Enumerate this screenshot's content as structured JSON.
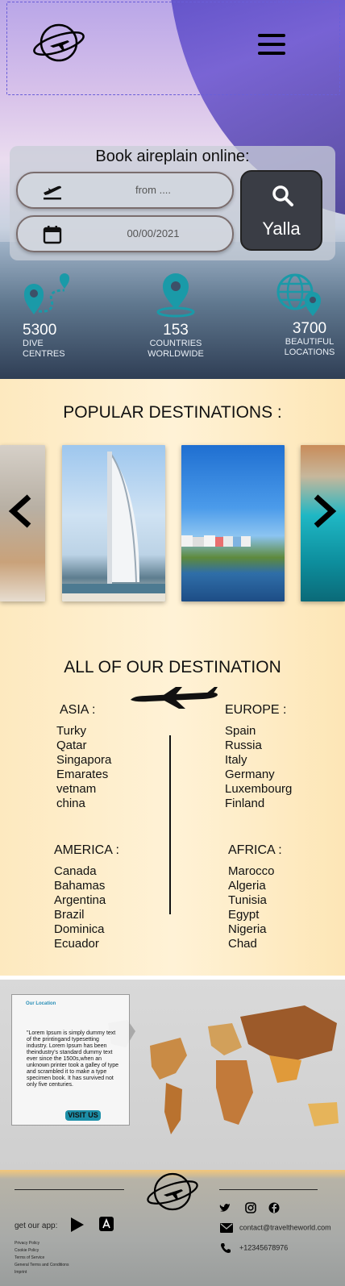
{
  "hero": {
    "booking_title": "Book aireplain online:",
    "from_placeholder": "from ....",
    "date_value": "00/00/2021",
    "search_button": "Yalla",
    "stats": [
      {
        "number": "5300",
        "caption_line1": "DIVE",
        "caption_line2": "CENTRES"
      },
      {
        "number": "153",
        "caption_line1": "COUNTRIES",
        "caption_line2": "WORLDWIDE"
      },
      {
        "number": "3700",
        "caption_line1": "BEAUTIFUL",
        "caption_line2": "LOCATIONS"
      }
    ]
  },
  "popular": {
    "title": "POPULAR DESTINATIONS :"
  },
  "all_destinations": {
    "title": "ALL OF OUR DESTINATION",
    "regions": [
      {
        "name": "ASIA :",
        "countries": [
          "Turky",
          "Qatar",
          "Singapora",
          "Emarates",
          "vetnam",
          "china"
        ]
      },
      {
        "name": "EUROPE :",
        "countries": [
          "Spain",
          "Russia",
          "Italy",
          "Germany",
          "Luxembourg",
          "Finland"
        ]
      },
      {
        "name": "AMERICA :",
        "countries": [
          "Canada",
          "Bahamas",
          "Argentina",
          "Brazil",
          "Dominica",
          "Ecuador"
        ]
      },
      {
        "name": "AFRICA :",
        "countries": [
          "Marocco",
          "Algeria",
          "Tunisia",
          "Egypt",
          "Nigeria",
          "Chad"
        ]
      }
    ]
  },
  "location": {
    "heading": "Our Location",
    "text": "\"Lorem Ipsum is simply dummy text of the printingand typesetting industry. Lorem Ipsum has been theindustry's standard dummy text ever since the 1500s,when an unknown printer took a galley of type and scrambled it to make a type specimen book. It has survived not only five centuries.",
    "button": "VISIT US"
  },
  "footer": {
    "get_app": "get our app:",
    "legal": [
      "Privacy Policy",
      "Cookie Policy",
      "Terms of Service",
      "General Terms and Conditions",
      "Imprint"
    ],
    "email": "contact@traveltheworld.com",
    "phone": "+12345678976"
  },
  "colors": {
    "accent_teal": "#1a9aa8",
    "hero_purple": "#5a48c8",
    "section_cream": "#fff2d6"
  }
}
